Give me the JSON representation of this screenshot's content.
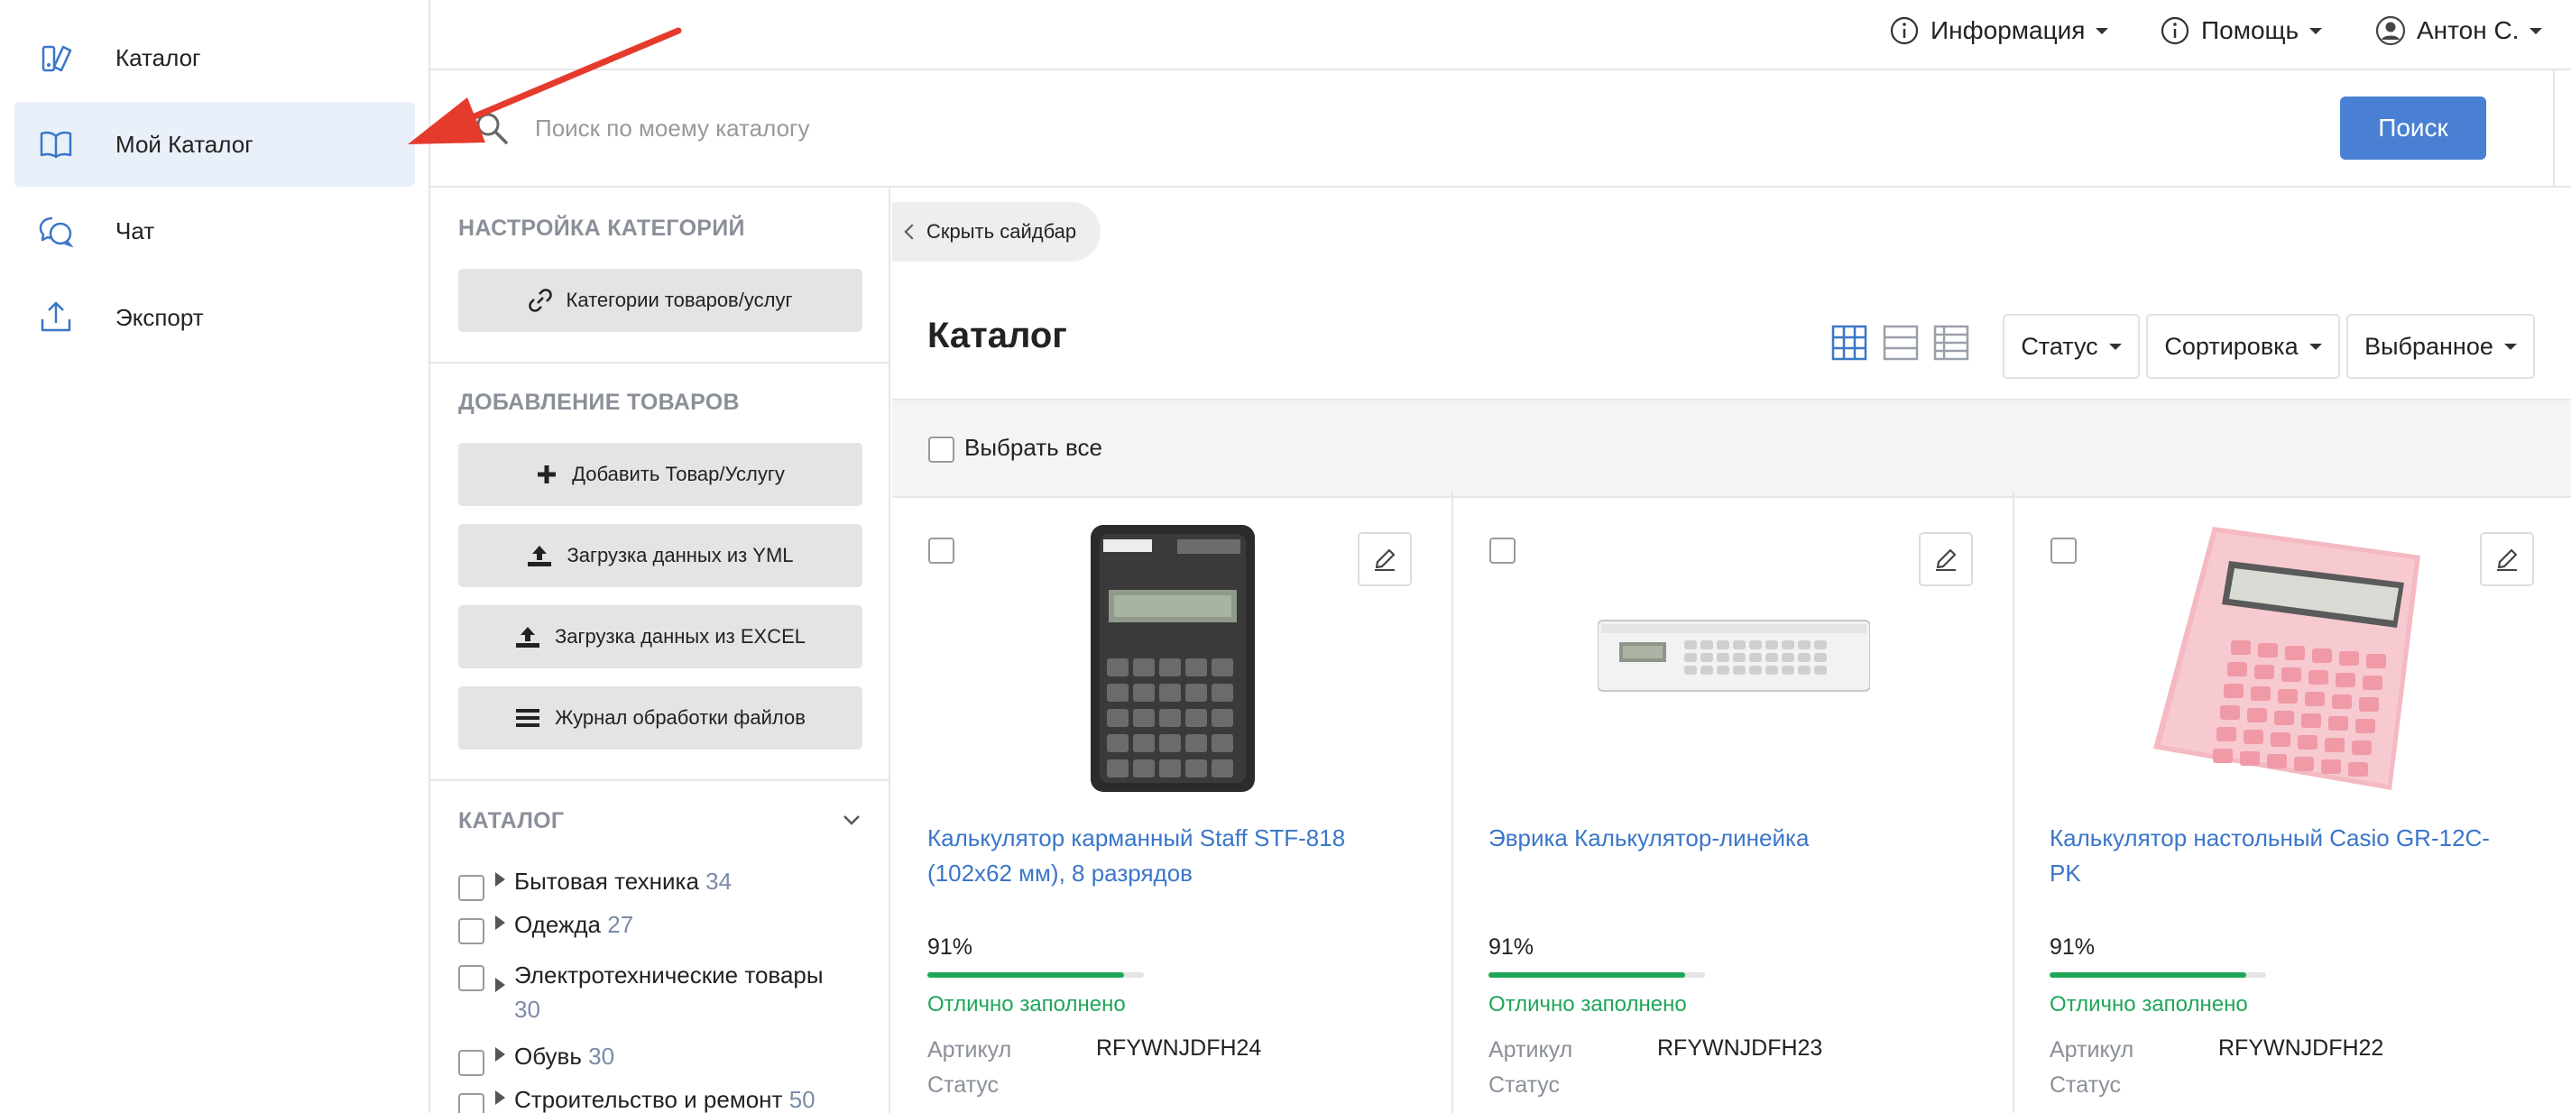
{
  "nav": {
    "items": [
      {
        "label": "Каталог",
        "icon": "catalog-icon"
      },
      {
        "label": "Мой Каталог",
        "icon": "book-icon",
        "active": true
      },
      {
        "label": "Чат",
        "icon": "chat-icon"
      },
      {
        "label": "Экспорт",
        "icon": "upload-icon"
      }
    ]
  },
  "topbar": {
    "info": "Информация",
    "help": "Помощь",
    "user": "Антон С."
  },
  "search": {
    "placeholder": "Поиск по моему каталогу",
    "button": "Поиск"
  },
  "sidebar": {
    "categories_title": "НАСТРОЙКА КАТЕГОРИЙ",
    "categories_button": "Категории товаров/услуг",
    "add_title": "ДОБАВЛЕНИЕ ТОВАРОВ",
    "add_buttons": [
      "Добавить Товар/Услугу",
      "Загрузка данных из YML",
      "Загрузка данных из EXCEL",
      "Журнал обработки файлов"
    ],
    "catalog_title": "КАТАЛОГ",
    "catalog": [
      {
        "name": "Бытовая техника",
        "count": "34"
      },
      {
        "name": "Одежда",
        "count": "27"
      },
      {
        "name": "Электротехнические товары",
        "count": "30"
      },
      {
        "name": "Обувь",
        "count": "30"
      },
      {
        "name": "Строительство и ремонт",
        "count": "50"
      }
    ]
  },
  "main": {
    "hide_sidebar": "Скрыть сайдбар",
    "title": "Каталог",
    "status": "Статус",
    "sort": "Сортировка",
    "selected": "Выбранное",
    "select_all": "Выбрать все",
    "accent_color": "#4a80d3",
    "success_color": "#1ea757"
  },
  "products": [
    {
      "title": "Калькулятор карманный Staff STF-818 (102x62 мм), 8 разрядов",
      "percent": "91%",
      "fill_fraction": 0.91,
      "fill_status": "Отлично заполнено",
      "sku_label": "Артикул",
      "sku": "RFYWNJDFH24",
      "status_label": "Статус"
    },
    {
      "title": "Эврика Калькулятор-линейка",
      "percent": "91%",
      "fill_fraction": 0.91,
      "fill_status": "Отлично заполнено",
      "sku_label": "Артикул",
      "sku": "RFYWNJDFH23",
      "status_label": "Статус"
    },
    {
      "title": "Калькулятор настольный Casio GR-12C-PK",
      "percent": "91%",
      "fill_fraction": 0.91,
      "fill_status": "Отлично заполнено",
      "sku_label": "Артикул",
      "sku": "RFYWNJDFH22",
      "status_label": "Статус"
    }
  ]
}
